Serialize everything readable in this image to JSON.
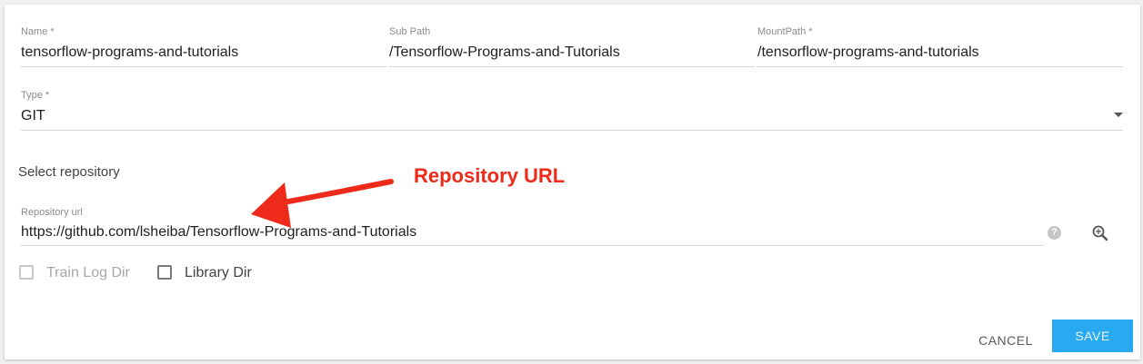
{
  "form": {
    "name": {
      "label": "Name *",
      "value": "tensorflow-programs-and-tutorials"
    },
    "sub_path": {
      "label": "Sub Path",
      "value": "/Tensorflow-Programs-and-Tutorials"
    },
    "mount_path": {
      "label": "MountPath *",
      "value": "/tensorflow-programs-and-tutorials"
    },
    "type": {
      "label": "Type *",
      "value": "GIT"
    },
    "select_repository_title": "Select repository",
    "repository_url": {
      "label": "Repository url",
      "value": "https://github.com/lsheiba/Tensorflow-Programs-and-Tutorials"
    },
    "help_glyph": "?",
    "checkboxes": [
      {
        "label": "Train Log Dir",
        "checked": false,
        "disabled": true
      },
      {
        "label": "Library Dir",
        "checked": false,
        "disabled": false
      }
    ]
  },
  "actions": {
    "cancel_label": "CANCEL",
    "save_label": "SAVE"
  },
  "annotation": {
    "text": "Repository URL"
  },
  "icons": {
    "help": "help-icon",
    "search": "search-icon",
    "dropdown": "dropdown-arrow-icon"
  },
  "colors": {
    "accent": "#29a9ef",
    "annotation": "#ee2b1a"
  }
}
